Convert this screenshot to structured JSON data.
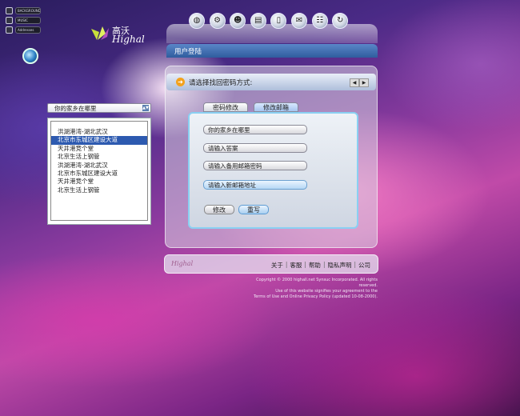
{
  "mini_nav": {
    "items": [
      "BACKGROUND",
      "MUSIC",
      "Addresses"
    ]
  },
  "logo": {
    "cn": "高沃",
    "en": "Highal"
  },
  "nav_icons": [
    "globe-icon",
    "gear-icon",
    "user-icon",
    "film-icon",
    "document-icon",
    "mail-icon",
    "contacts-icon",
    "refresh-icon"
  ],
  "header": {
    "title": "用户登陆"
  },
  "strip": {
    "title": "请选择找回密码方式:"
  },
  "tabs": [
    {
      "label": "密码修改"
    },
    {
      "label": "修改邮箱"
    }
  ],
  "form": {
    "fields": [
      "你的家乡在哪里",
      "请输入答案",
      "请输入备用邮箱密码",
      "请输入新邮箱地址"
    ],
    "buttons": [
      "修改",
      "重写"
    ]
  },
  "left_select": {
    "value": "你的家乡在哪里"
  },
  "left_list": {
    "items": [
      "洪湖港湾-湖北武汉",
      "北京市东城区建设大道",
      "天井港竞个堂",
      "北京生活上钢管",
      "洪湖港湾-湖北武汉",
      "北京市东城区建设大道",
      "天井港竞个堂",
      "北京生活上钢管"
    ],
    "selected_index": 1
  },
  "footer": {
    "links": [
      "关于",
      "客服",
      "帮助",
      "隐私声明",
      "公司"
    ],
    "copyright": [
      "Copyright © 2000 highall.net Synsuc Incorporated. All rights reserved.",
      "Use of this website signifies your agreement to the",
      "Terms of Use and Online Privacy Policy (updated 10-08-2000)."
    ]
  }
}
